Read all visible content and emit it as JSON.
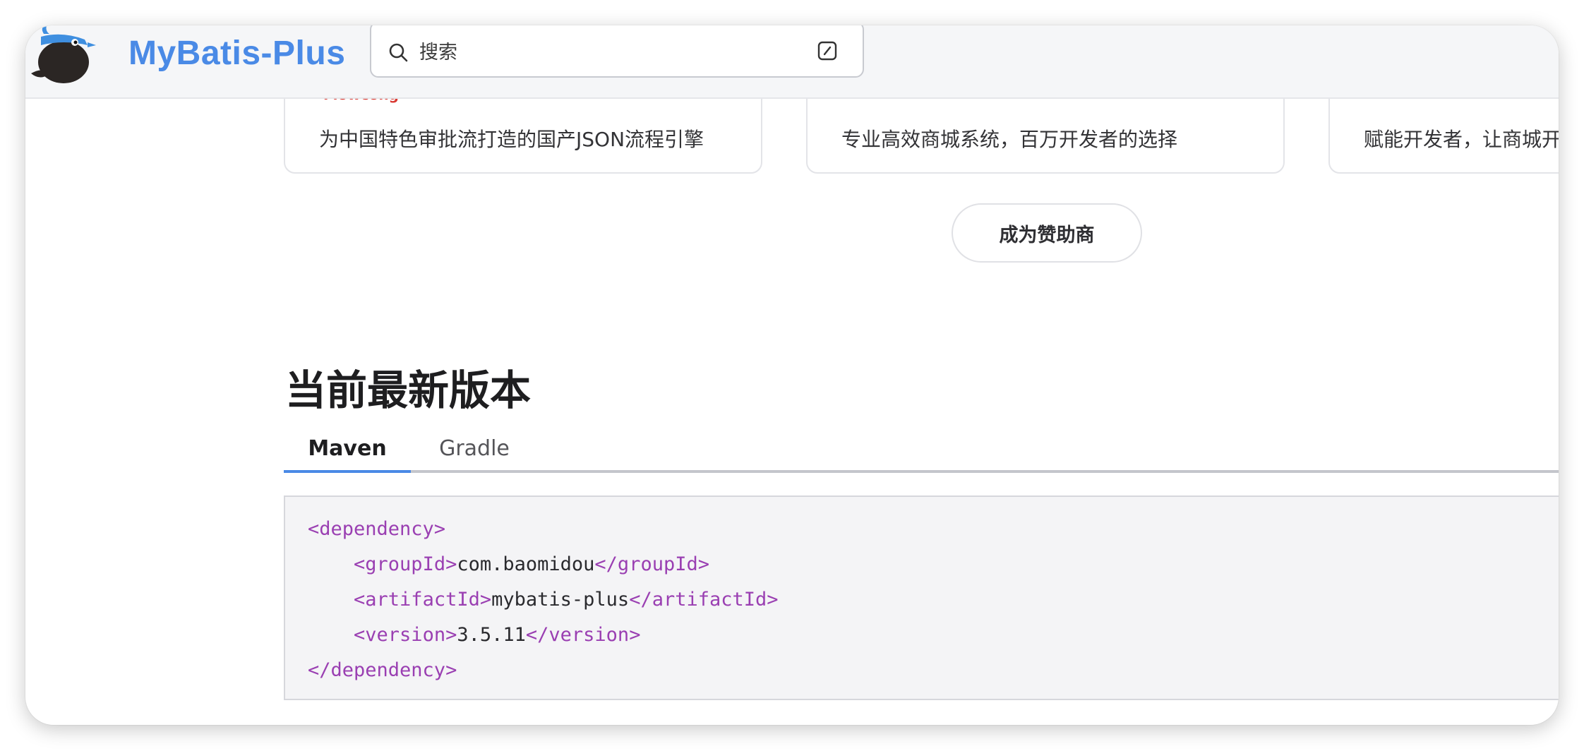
{
  "navbar": {
    "title": "MyBatis-Plus",
    "search_placeholder": "搜索"
  },
  "sponsors": [
    {
      "tag": "Flowcong",
      "description": "为中国特色审批流打造的国产JSON流程引擎"
    },
    {
      "tag": "",
      "description": "专业高效商城系统，百万开发者的选择"
    },
    {
      "tag": "",
      "description": "赋能开发者，让商城开"
    }
  ],
  "sponsor_button": "成为赞助商",
  "version_section": {
    "title": "当前最新版本",
    "tabs": [
      {
        "label": "Maven",
        "active": true
      },
      {
        "label": "Gradle",
        "active": false
      }
    ],
    "code": {
      "dependency_open": "<dependency>",
      "group_open": "<groupId>",
      "group_value": "com.baomidou",
      "group_close": "</groupId>",
      "artifact_open": "<artifactId>",
      "artifact_value": "mybatis-plus",
      "artifact_close": "</artifactId>",
      "version_open": "<version>",
      "version_value": "3.5.11",
      "version_close": "</version>",
      "dependency_close": "</dependency>"
    }
  },
  "colors": {
    "brand": "#4a8ae6",
    "code_tag": "#9a3fb2",
    "sponsor_tag": "#d93a33"
  }
}
